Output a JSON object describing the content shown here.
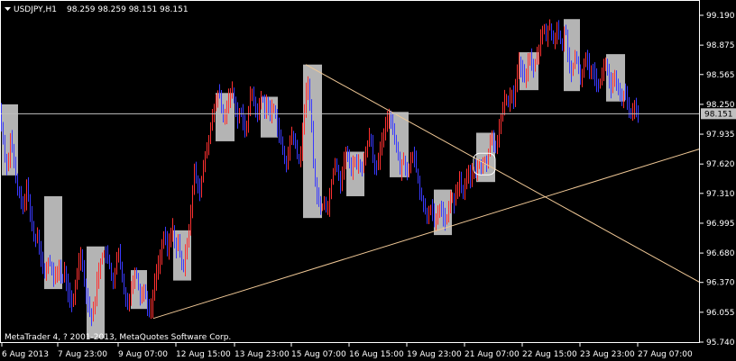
{
  "header": {
    "dropdown_icon": "triangle-down-icon",
    "symbol": "USDJPY,H1",
    "ohlc": "98.259 98.259 98.151 98.151"
  },
  "copyright": "MetaTrader 4, ? 2001-2013, MetaQuotes Software Corp.",
  "colors": {
    "background": "#000000",
    "grid_frame": "#ffffff",
    "bull_bar": "#ff3030",
    "bear_bar": "#3a3aff",
    "highlight_box": "#b4b4b4",
    "trendline": "#f0c896",
    "bid_line": "#c0c0c0",
    "price_tag_bg": "#c0c0c0",
    "price_tag_text": "#000000"
  },
  "chart_data": {
    "type": "ohlc",
    "symbol": "USDJPY",
    "timeframe": "H1",
    "y_ticks": [
      "99.190",
      "98.875",
      "98.565",
      "98.250",
      "97.935",
      "97.620",
      "97.310",
      "96.995",
      "96.680",
      "96.370",
      "96.055",
      "95.740"
    ],
    "ylim": [
      95.74,
      99.19
    ],
    "x_ticks": [
      "6 Aug 2013",
      "7 Aug 23:00",
      "9 Aug 07:00",
      "12 Aug 15:00",
      "13 Aug 23:00",
      "15 Aug 07:00",
      "16 Aug 15:00",
      "19 Aug 23:00",
      "21 Aug 07:00",
      "22 Aug 15:00",
      "23 Aug 23:00",
      "27 Aug 07:00"
    ],
    "current_price": "98.151",
    "close_path": [
      [
        0,
        98.2
      ],
      [
        3,
        97.95
      ],
      [
        6,
        97.7
      ],
      [
        9,
        97.55
      ],
      [
        12,
        97.9
      ],
      [
        15,
        97.7
      ],
      [
        18,
        97.45
      ],
      [
        21,
        97.3
      ],
      [
        24,
        97.25
      ],
      [
        27,
        97.1
      ],
      [
        30,
        97.4
      ],
      [
        33,
        97.2
      ],
      [
        36,
        96.95
      ],
      [
        39,
        96.8
      ],
      [
        42,
        96.9
      ],
      [
        45,
        96.7
      ],
      [
        48,
        96.5
      ],
      [
        51,
        96.45
      ],
      [
        54,
        96.6
      ],
      [
        57,
        96.55
      ],
      [
        60,
        96.4
      ],
      [
        63,
        96.45
      ],
      [
        66,
        96.55
      ],
      [
        69,
        96.35
      ],
      [
        72,
        96.5
      ],
      [
        75,
        96.3
      ],
      [
        78,
        96.2
      ],
      [
        81,
        96.1
      ],
      [
        84,
        96.35
      ],
      [
        87,
        96.55
      ],
      [
        90,
        96.7
      ],
      [
        93,
        96.45
      ],
      [
        96,
        96.25
      ],
      [
        99,
        96.1
      ],
      [
        102,
        96.0
      ],
      [
        105,
        96.1
      ],
      [
        108,
        96.4
      ],
      [
        111,
        96.55
      ],
      [
        114,
        96.65
      ],
      [
        117,
        96.7
      ],
      [
        120,
        96.6
      ],
      [
        123,
        96.5
      ],
      [
        126,
        96.35
      ],
      [
        129,
        96.55
      ],
      [
        132,
        96.7
      ],
      [
        135,
        96.45
      ],
      [
        138,
        96.3
      ],
      [
        141,
        96.15
      ],
      [
        144,
        96.2
      ],
      [
        147,
        96.35
      ],
      [
        150,
        96.5
      ],
      [
        153,
        96.4
      ],
      [
        156,
        96.2
      ],
      [
        159,
        96.3
      ],
      [
        162,
        96.25
      ],
      [
        165,
        96.05
      ],
      [
        168,
        96.1
      ],
      [
        171,
        96.3
      ],
      [
        174,
        96.5
      ],
      [
        177,
        96.6
      ],
      [
        180,
        96.75
      ],
      [
        183,
        96.9
      ],
      [
        186,
        96.7
      ],
      [
        189,
        96.85
      ],
      [
        192,
        96.95
      ],
      [
        195,
        96.7
      ],
      [
        198,
        96.8
      ],
      [
        201,
        96.6
      ],
      [
        204,
        96.5
      ],
      [
        207,
        96.75
      ],
      [
        210,
        96.95
      ],
      [
        213,
        97.25
      ],
      [
        216,
        97.55
      ],
      [
        219,
        97.4
      ],
      [
        222,
        97.3
      ],
      [
        225,
        97.55
      ],
      [
        228,
        97.7
      ],
      [
        231,
        97.85
      ],
      [
        234,
        98.0
      ],
      [
        237,
        98.15
      ],
      [
        240,
        98.3
      ],
      [
        243,
        98.4
      ],
      [
        246,
        98.2
      ],
      [
        249,
        98.05
      ],
      [
        252,
        98.25
      ],
      [
        255,
        98.35
      ],
      [
        258,
        98.4
      ],
      [
        261,
        98.25
      ],
      [
        264,
        98.1
      ],
      [
        267,
        98.2
      ],
      [
        270,
        98.05
      ],
      [
        273,
        97.95
      ],
      [
        276,
        98.2
      ],
      [
        279,
        98.4
      ],
      [
        282,
        98.3
      ],
      [
        285,
        98.1
      ],
      [
        288,
        98.25
      ],
      [
        291,
        98.35
      ],
      [
        294,
        98.2
      ],
      [
        297,
        98.3
      ],
      [
        300,
        98.1
      ],
      [
        303,
        98.25
      ],
      [
        306,
        98.15
      ],
      [
        309,
        97.95
      ],
      [
        312,
        97.85
      ],
      [
        315,
        97.7
      ],
      [
        318,
        97.6
      ],
      [
        321,
        97.8
      ],
      [
        324,
        97.95
      ],
      [
        327,
        97.85
      ],
      [
        330,
        97.7
      ],
      [
        333,
        97.65
      ],
      [
        336,
        97.95
      ],
      [
        339,
        98.35
      ],
      [
        342,
        98.45
      ],
      [
        345,
        98.2
      ],
      [
        348,
        97.6
      ],
      [
        351,
        97.35
      ],
      [
        354,
        97.2
      ],
      [
        357,
        97.15
      ],
      [
        360,
        97.25
      ],
      [
        363,
        97.1
      ],
      [
        366,
        97.3
      ],
      [
        369,
        97.5
      ],
      [
        372,
        97.65
      ],
      [
        375,
        97.55
      ],
      [
        378,
        97.4
      ],
      [
        381,
        97.6
      ],
      [
        384,
        97.75
      ],
      [
        387,
        97.65
      ],
      [
        390,
        97.55
      ],
      [
        393,
        97.7
      ],
      [
        396,
        97.6
      ],
      [
        399,
        97.65
      ],
      [
        402,
        97.55
      ],
      [
        405,
        97.7
      ],
      [
        408,
        97.85
      ],
      [
        411,
        97.95
      ],
      [
        414,
        97.7
      ],
      [
        417,
        97.55
      ],
      [
        420,
        97.65
      ],
      [
        423,
        97.8
      ],
      [
        426,
        97.95
      ],
      [
        429,
        98.05
      ],
      [
        432,
        98.15
      ],
      [
        435,
        98.05
      ],
      [
        438,
        97.9
      ],
      [
        441,
        97.75
      ],
      [
        444,
        97.55
      ],
      [
        447,
        97.7
      ],
      [
        450,
        97.6
      ],
      [
        453,
        97.5
      ],
      [
        456,
        97.65
      ],
      [
        459,
        97.75
      ],
      [
        462,
        97.55
      ],
      [
        465,
        97.4
      ],
      [
        468,
        97.25
      ],
      [
        471,
        97.15
      ],
      [
        474,
        97.05
      ],
      [
        477,
        97.2
      ],
      [
        480,
        97.1
      ],
      [
        483,
        96.95
      ],
      [
        486,
        97.1
      ],
      [
        489,
        97.2
      ],
      [
        492,
        97.05
      ],
      [
        495,
        97.0
      ],
      [
        498,
        97.15
      ],
      [
        501,
        97.3
      ],
      [
        504,
        97.2
      ],
      [
        507,
        97.35
      ],
      [
        510,
        97.45
      ],
      [
        513,
        97.3
      ],
      [
        516,
        97.4
      ],
      [
        519,
        97.55
      ],
      [
        522,
        97.45
      ],
      [
        525,
        97.6
      ],
      [
        528,
        97.5
      ],
      [
        531,
        97.65
      ],
      [
        534,
        97.55
      ],
      [
        537,
        97.7
      ],
      [
        540,
        97.6
      ],
      [
        543,
        97.8
      ],
      [
        546,
        97.95
      ],
      [
        549,
        97.75
      ],
      [
        552,
        97.9
      ],
      [
        555,
        98.05
      ],
      [
        558,
        98.2
      ],
      [
        561,
        98.35
      ],
      [
        564,
        98.25
      ],
      [
        567,
        98.4
      ],
      [
        570,
        98.3
      ],
      [
        573,
        98.55
      ],
      [
        576,
        98.7
      ],
      [
        579,
        98.6
      ],
      [
        582,
        98.5
      ],
      [
        585,
        98.65
      ],
      [
        588,
        98.75
      ],
      [
        591,
        98.6
      ],
      [
        594,
        98.7
      ],
      [
        597,
        98.8
      ],
      [
        600,
        98.95
      ],
      [
        603,
        99.05
      ],
      [
        606,
        98.95
      ],
      [
        609,
        99.1
      ],
      [
        612,
        99.0
      ],
      [
        615,
        98.9
      ],
      [
        618,
        99.05
      ],
      [
        621,
        98.95
      ],
      [
        624,
        98.85
      ],
      [
        627,
        99.1
      ],
      [
        630,
        98.8
      ],
      [
        633,
        98.55
      ],
      [
        636,
        98.65
      ],
      [
        639,
        98.75
      ],
      [
        642,
        98.6
      ],
      [
        645,
        98.5
      ],
      [
        648,
        98.7
      ],
      [
        651,
        98.75
      ],
      [
        654,
        98.6
      ],
      [
        657,
        98.65
      ],
      [
        660,
        98.55
      ],
      [
        663,
        98.45
      ],
      [
        666,
        98.5
      ],
      [
        669,
        98.6
      ],
      [
        672,
        98.7
      ],
      [
        675,
        98.55
      ],
      [
        678,
        98.4
      ],
      [
        681,
        98.55
      ],
      [
        684,
        98.45
      ],
      [
        687,
        98.35
      ],
      [
        690,
        98.3
      ],
      [
        693,
        98.4
      ],
      [
        696,
        98.25
      ],
      [
        699,
        98.1
      ],
      [
        702,
        98.2
      ],
      [
        705,
        98.25
      ],
      [
        708,
        98.15
      ]
    ],
    "highlight_boxes": [
      {
        "x0": 2,
        "x1": 20,
        "hi": 98.25,
        "lo": 97.5
      },
      {
        "x0": 49,
        "x1": 69,
        "hi": 97.28,
        "lo": 96.3
      },
      {
        "x0": 96,
        "x1": 116,
        "hi": 96.75,
        "lo": 95.78
      },
      {
        "x0": 145,
        "x1": 163,
        "hi": 96.5,
        "lo": 96.09
      },
      {
        "x0": 192,
        "x1": 212,
        "hi": 96.92,
        "lo": 96.39
      },
      {
        "x0": 239,
        "x1": 260,
        "hi": 98.37,
        "lo": 97.86
      },
      {
        "x0": 289,
        "x1": 308,
        "hi": 98.33,
        "lo": 97.9
      },
      {
        "x0": 336,
        "x1": 357,
        "hi": 98.67,
        "lo": 97.05
      },
      {
        "x0": 384,
        "x1": 404,
        "hi": 97.75,
        "lo": 97.28
      },
      {
        "x0": 432,
        "x1": 453,
        "hi": 98.17,
        "lo": 97.48
      },
      {
        "x0": 481,
        "x1": 501,
        "hi": 97.35,
        "lo": 96.87
      },
      {
        "x0": 528,
        "x1": 549,
        "hi": 97.95,
        "lo": 97.43
      },
      {
        "x0": 576,
        "x1": 597,
        "hi": 98.8,
        "lo": 98.4
      },
      {
        "x0": 625,
        "x1": 643,
        "hi": 99.15,
        "lo": 98.39
      },
      {
        "x0": 672,
        "x1": 693,
        "hi": 98.78,
        "lo": 98.28
      }
    ],
    "trendlines": [
      {
        "x0": 339,
        "y0": 98.67,
        "x1": 776,
        "y1": 96.37
      },
      {
        "x0": 170,
        "y0": 95.99,
        "x1": 776,
        "y1": 97.78
      }
    ],
    "marker_circle": {
      "x": 537,
      "y": 97.62
    }
  }
}
